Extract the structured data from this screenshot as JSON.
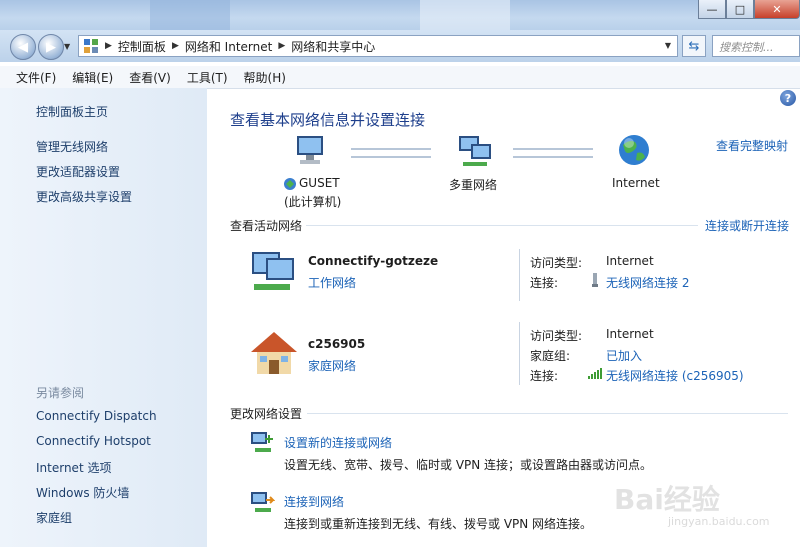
{
  "window": {
    "minimize_glyph": "—",
    "maximize_glyph": "□",
    "close_glyph": "✕"
  },
  "address_bar": {
    "crumbs": [
      "控制面板",
      "网络和 Internet",
      "网络和共享中心"
    ],
    "search_placeholder": "搜索控制..."
  },
  "menu": [
    "文件(F)",
    "编辑(E)",
    "查看(V)",
    "工具(T)",
    "帮助(H)"
  ],
  "sidebar": {
    "links": [
      "控制面板主页",
      "管理无线网络",
      "更改适配器设置",
      "更改高级共享设置"
    ],
    "see_also_title": "另请参阅",
    "see_also": [
      "Connectify Dispatch",
      "Connectify Hotspot",
      "Internet 选项",
      "Windows 防火墙",
      "家庭组"
    ]
  },
  "main": {
    "title": "查看基本网络信息并设置连接",
    "full_map_link": "查看完整映射",
    "map": {
      "computer_name": "GUSET",
      "computer_sub": "(此计算机)",
      "middle": "多重网络",
      "internet": "Internet"
    },
    "active_title": "查看活动网络",
    "connect_disconnect_link": "连接或断开连接",
    "networks": [
      {
        "name": "Connectify-gotzeze",
        "type": "工作网络",
        "access_label": "访问类型:",
        "access_value": "Internet",
        "conn_label": "连接:",
        "conn_value": "无线网络连接 2"
      },
      {
        "name": "c256905",
        "type": "家庭网络",
        "access_label": "访问类型:",
        "access_value": "Internet",
        "homegroup_label": "家庭组:",
        "homegroup_value": "已加入",
        "conn_label": "连接:",
        "conn_value": "无线网络连接 (c256905)"
      }
    ],
    "change_title": "更改网络设置",
    "tasks": [
      {
        "link": "设置新的连接或网络",
        "desc": "设置无线、宽带、拨号、临时或 VPN 连接；或设置路由器或访问点。"
      },
      {
        "link": "连接到网络",
        "desc": "连接到或重新连接到无线、有线、拨号或 VPN 网络连接。"
      }
    ]
  },
  "watermark": {
    "brand": "Bai经验",
    "url": "jingyan.baidu.com"
  }
}
